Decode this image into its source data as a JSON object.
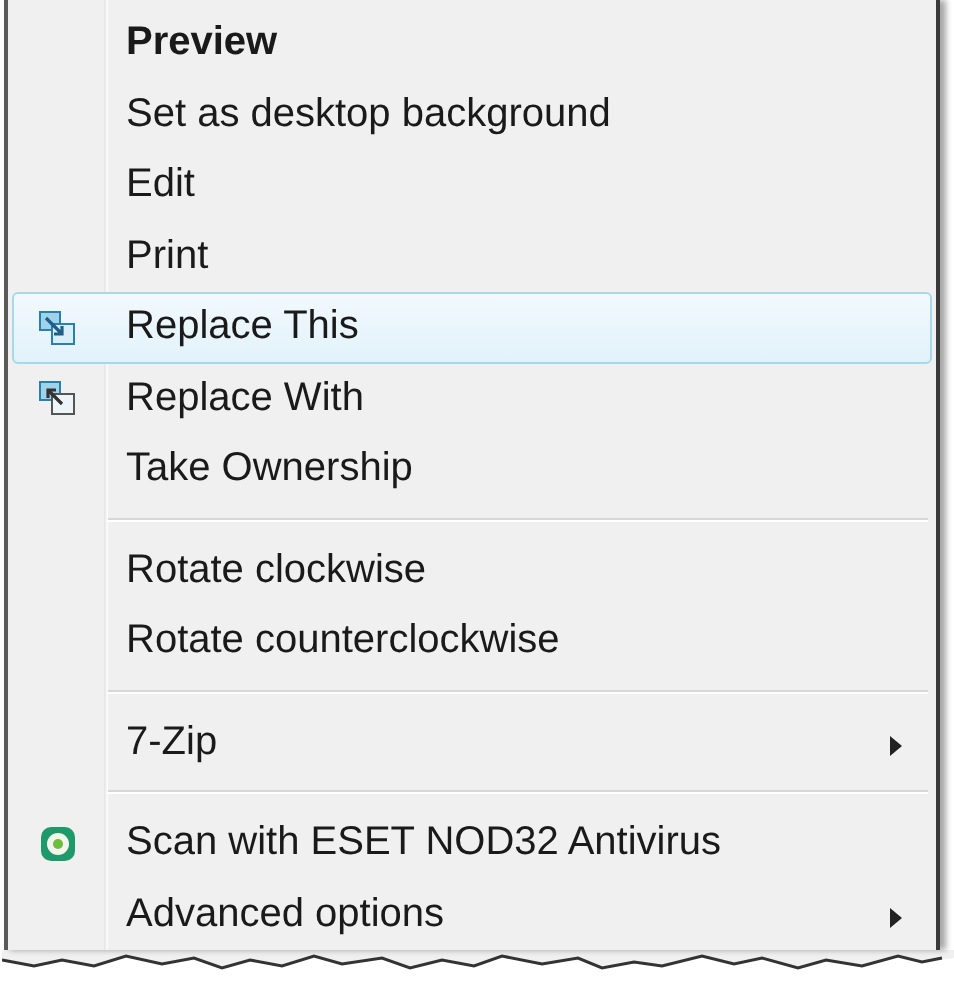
{
  "menu": {
    "items": [
      {
        "kind": "item",
        "label": "Preview",
        "bold": true,
        "selected": false
      },
      {
        "kind": "item",
        "label": "Set as desktop background",
        "selected": false
      },
      {
        "kind": "item",
        "label": "Edit",
        "selected": false
      },
      {
        "kind": "item",
        "label": "Print",
        "selected": false
      },
      {
        "kind": "replace_this",
        "label": "Replace This",
        "selected": true
      },
      {
        "kind": "replace_with",
        "label": "Replace With",
        "selected": false
      },
      {
        "kind": "item",
        "label": "Take Ownership",
        "selected": false
      },
      {
        "kind": "separator"
      },
      {
        "kind": "item",
        "label": "Rotate clockwise",
        "selected": false
      },
      {
        "kind": "item",
        "label": "Rotate counterclockwise",
        "selected": false
      },
      {
        "kind": "separator"
      },
      {
        "kind": "item",
        "label": "7-Zip",
        "selected": false,
        "submenu": true
      },
      {
        "kind": "separator"
      },
      {
        "kind": "antivirus",
        "label": "Scan with ESET NOD32 Antivirus",
        "selected": false
      },
      {
        "kind": "item",
        "label": "Advanced options",
        "selected": false,
        "submenu": true
      }
    ]
  }
}
